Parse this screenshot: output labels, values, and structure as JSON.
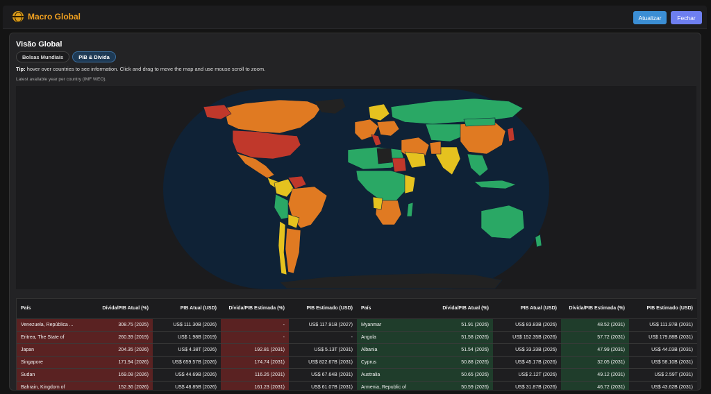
{
  "app": {
    "title": "Macro Global"
  },
  "actions": {
    "update_label": "Atualizar",
    "close_label": "Fechar"
  },
  "page": {
    "title": "Visão Global",
    "tabs": [
      {
        "label": "Bolsas Mundiais",
        "active": false
      },
      {
        "label": "PIB & Dívida",
        "active": true
      }
    ],
    "tip_label": "Tip:",
    "tip_text": " hover over countries to see information. Click and drag to move the map and use mouse scroll to zoom.",
    "note": "Latest available year per country (IMF WEO)."
  },
  "map": {
    "ocean_color": "#0f2236",
    "colors": {
      "green": "#2aa865",
      "yellow": "#e5c21f",
      "orange": "#e07a22",
      "red": "#c0382b",
      "black": "#222222"
    }
  },
  "table": {
    "columns": [
      "País",
      "Dívida/PIB Atual (%)",
      "PIB Atual (USD)",
      "Dívida/PIB Estimada (%)",
      "PIB Estimado (USD)"
    ],
    "left_rows": [
      [
        "Venezuela, República ...",
        "308.75 (2025)",
        "US$ 111.30B (2026)",
        "-",
        "US$ 117.91B (2027)"
      ],
      [
        "Eritrea, The State of",
        "260.39 (2019)",
        "US$ 1.98B (2019)",
        "-",
        "-"
      ],
      [
        "Japan",
        "204.35 (2026)",
        "US$ 4.38T (2026)",
        "192.81 (2031)",
        "US$ 5.13T (2031)"
      ],
      [
        "Singapore",
        "171.94 (2026)",
        "US$ 659.57B (2026)",
        "174.74 (2031)",
        "US$ 822.67B (2031)"
      ],
      [
        "Sudan",
        "169.08 (2026)",
        "US$ 44.69B (2026)",
        "116.26 (2031)",
        "US$ 67.64B (2031)"
      ],
      [
        "Bahrain, Kingdom of",
        "152.36 (2026)",
        "US$ 48.85B (2026)",
        "161.23 (2031)",
        "US$ 61.07B (2031)"
      ]
    ],
    "right_rows": [
      [
        "Myanmar",
        "51.91 (2026)",
        "US$ 83.83B (2026)",
        "48.52 (2031)",
        "US$ 111.97B (2031)"
      ],
      [
        "Angola",
        "51.58 (2026)",
        "US$ 152.35B (2026)",
        "57.72 (2031)",
        "US$ 179.88B (2031)"
      ],
      [
        "Albania",
        "51.54 (2026)",
        "US$ 33.33B (2026)",
        "47.99 (2031)",
        "US$ 44.03B (2031)"
      ],
      [
        "Cyprus",
        "50.88 (2026)",
        "US$ 45.17B (2026)",
        "32.05 (2031)",
        "US$ 58.10B (2031)"
      ],
      [
        "Australia",
        "50.65 (2026)",
        "US$ 2.12T (2026)",
        "49.12 (2031)",
        "US$ 2.59T (2031)"
      ],
      [
        "Armenia, Republic of",
        "50.59 (2026)",
        "US$ 31.87B (2026)",
        "46.72 (2031)",
        "US$ 43.62B (2031)"
      ]
    ]
  }
}
